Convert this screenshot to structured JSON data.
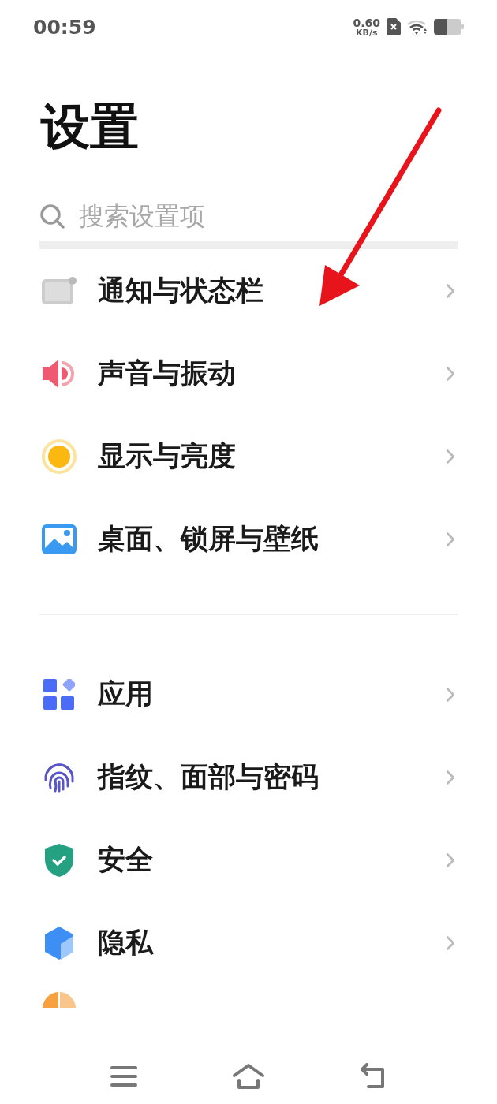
{
  "status_bar": {
    "time": "00:59",
    "net_speed": "0.60",
    "net_unit": "KB/s"
  },
  "title": "设置",
  "search": {
    "placeholder": "搜索设置项"
  },
  "groups": [
    {
      "items": [
        {
          "kind": "notification",
          "label": "通知与状态栏"
        },
        {
          "kind": "sound",
          "label": "声音与振动"
        },
        {
          "kind": "display",
          "label": "显示与亮度"
        },
        {
          "kind": "wallpaper",
          "label": "桌面、锁屏与壁纸"
        }
      ]
    },
    {
      "items": [
        {
          "kind": "apps",
          "label": "应用"
        },
        {
          "kind": "fingerprint",
          "label": "指纹、面部与密码"
        },
        {
          "kind": "security",
          "label": "安全"
        },
        {
          "kind": "privacy",
          "label": "隐私"
        }
      ]
    }
  ],
  "partial_row": {
    "kind": "storage"
  },
  "nav_bar": {
    "buttons": [
      {
        "kind": "menu"
      },
      {
        "kind": "home"
      },
      {
        "kind": "back"
      }
    ]
  }
}
